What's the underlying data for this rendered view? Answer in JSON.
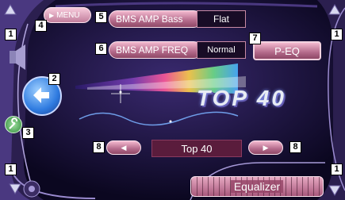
{
  "menu_button": {
    "label": "MENU",
    "icon": "play-icon"
  },
  "bass": {
    "label": "BMS AMP Bass",
    "value": "Flat"
  },
  "freq": {
    "label": "BMS AMP FREQ",
    "value": "Normal"
  },
  "peq": {
    "label": "P-EQ"
  },
  "preset": {
    "name": "Top 40",
    "prev_icon": "chevron-left-icon",
    "next_icon": "chevron-right-icon"
  },
  "equalizer": {
    "label": "Equalizer"
  },
  "album_art": {
    "text": "TOP 40"
  },
  "callouts": {
    "c1_top_left": "1",
    "c1_top_right": "1",
    "c1_bottom_left": "1",
    "c1_bottom_right": "1",
    "c2": "2",
    "c3": "3",
    "c4": "4",
    "c5": "5",
    "c6": "6",
    "c7": "7",
    "c8_left": "8",
    "c8_right": "8"
  },
  "colors": {
    "accent_pink": "#c97a9a",
    "background": "#0b0720",
    "frame": "#3b2c63"
  }
}
